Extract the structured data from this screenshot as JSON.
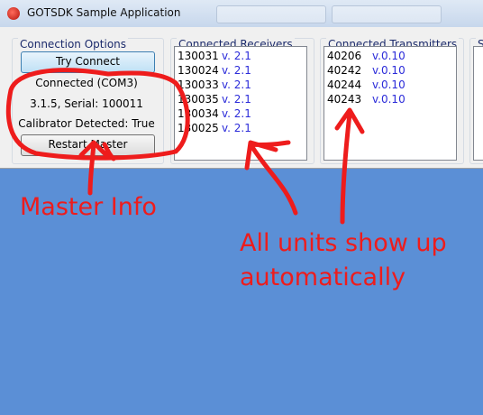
{
  "window": {
    "title": "GOTSDK Sample Application"
  },
  "connection_options": {
    "group_title": "Connection Options",
    "try_connect_label": "Try Connect",
    "status": "Connected (COM3)",
    "serial_line": "3.1.5, Serial: 100011",
    "calibrator_line": "Calibrator Detected:  True",
    "restart_label": "Restart Master"
  },
  "receivers": {
    "group_title": "Connected Receivers",
    "items": [
      {
        "id": "130031",
        "version": "v. 2.1"
      },
      {
        "id": "130024",
        "version": "v. 2.1"
      },
      {
        "id": "130033",
        "version": "v. 2.1"
      },
      {
        "id": "130035",
        "version": "v. 2.1"
      },
      {
        "id": "130034",
        "version": "v. 2.1"
      },
      {
        "id": "130025",
        "version": "v. 2.1"
      }
    ]
  },
  "transmitters": {
    "group_title": "Connected Transmitters",
    "items": [
      {
        "id": "40206",
        "version": "v.0.10"
      },
      {
        "id": "40242",
        "version": "v.0.10"
      },
      {
        "id": "40244",
        "version": "v.0.10"
      },
      {
        "id": "40243",
        "version": "v.0.10"
      }
    ]
  },
  "extra_group": {
    "group_title": "Se"
  },
  "annotations": {
    "master_info": "Master Info",
    "units_line1": "All units show up",
    "units_line2": "automatically",
    "color": "#ee1c1c"
  },
  "colors": {
    "viewport_blue": "#5b8fd6",
    "version_blue": "#2b2bd9"
  }
}
